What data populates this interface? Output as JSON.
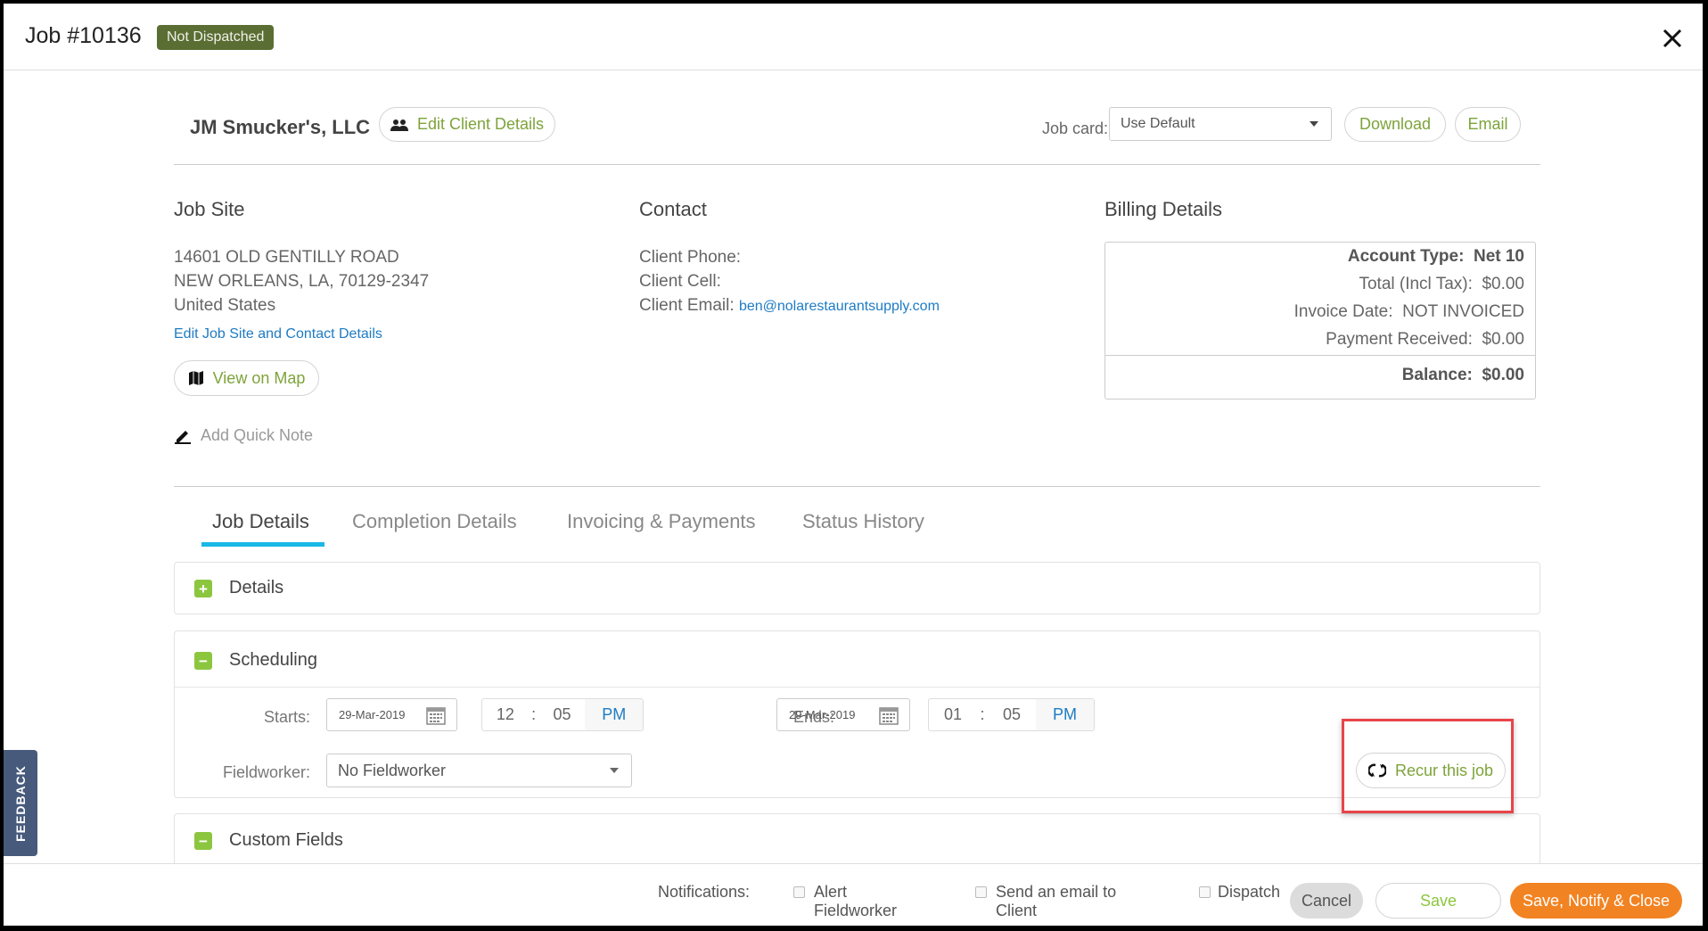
{
  "header": {
    "title": "Job #10136",
    "status_badge": "Not Dispatched",
    "close_icon": "close-icon"
  },
  "client": {
    "name": "JM Smucker's, LLC",
    "edit_button": "Edit Client Details",
    "edit_icon": "people-icon"
  },
  "job_card": {
    "label": "Job card:",
    "selected": "Use Default",
    "download_button": "Download",
    "email_button": "Email"
  },
  "job_site": {
    "heading": "Job Site",
    "address_line1": "14601 OLD GENTILLY ROAD",
    "address_line2": "NEW ORLEANS, LA, 70129-2347",
    "country": "United States",
    "edit_link": "Edit Job Site and Contact Details",
    "map_button": "View on Map",
    "map_icon": "map-icon",
    "quick_note": "Add Quick Note",
    "quick_note_icon": "pencil-icon"
  },
  "contact": {
    "heading": "Contact",
    "phone_label": "Client Phone:",
    "phone_value": "",
    "cell_label": "Client Cell:",
    "cell_value": "",
    "email_label": "Client Email:",
    "email_value": "ben@nolarestaurantsupply.com"
  },
  "billing": {
    "heading": "Billing Details",
    "account_type_label": "Account Type:",
    "account_type_value": "Net 10",
    "total_label": "Total (Incl Tax):",
    "total_value": "$0.00",
    "invoice_date_label": "Invoice Date:",
    "invoice_date_value": "NOT INVOICED",
    "payment_label": "Payment Received:",
    "payment_value": "$0.00",
    "balance_label": "Balance:",
    "balance_value": "$0.00"
  },
  "tabs": [
    {
      "label": "Job Details",
      "active": true
    },
    {
      "label": "Completion Details",
      "active": false
    },
    {
      "label": "Invoicing & Payments",
      "active": false
    },
    {
      "label": "Status History",
      "active": false
    }
  ],
  "panels": {
    "details": {
      "title": "Details",
      "toggle": "+"
    },
    "scheduling": {
      "title": "Scheduling",
      "toggle": "−"
    },
    "custom_fields": {
      "title": "Custom Fields",
      "toggle": "−"
    }
  },
  "scheduling": {
    "starts_label": "Starts:",
    "start_date": "29-Mar-2019",
    "start_hour": "12",
    "start_minute": "05",
    "start_ampm": "PM",
    "ends_label": "Ends:",
    "end_date": "29-Mar-2019",
    "end_hour": "01",
    "end_minute": "05",
    "end_ampm": "PM",
    "time_separator": ":",
    "fieldworker_label": "Fieldworker:",
    "fieldworker_value": "No Fieldworker",
    "recur_button": "Recur this job",
    "recur_icon": "refresh-icon"
  },
  "feedback_tab": "FEEDBACK",
  "footer": {
    "notifications_label": "Notifications:",
    "alert_fieldworker_line1": "Alert",
    "alert_fieldworker_line2": "Fieldworker",
    "alert_fieldworker_checked": false,
    "email_client_line1": "Send an email to",
    "email_client_line2": "Client",
    "email_client_checked": false,
    "dispatch_label": "Dispatch",
    "dispatch_checked": false,
    "cancel_button": "Cancel",
    "save_button": "Save",
    "save_notify_close_button": "Save, Notify & Close"
  },
  "colors": {
    "accent_green": "#7ea33a",
    "status_badge": "#5a6e33",
    "tab_underline": "#1ab8e6",
    "toggle_green": "#8cc63f",
    "primary_orange": "#f28322",
    "link_blue": "#1e7bc4",
    "highlight_red": "#e8454a",
    "feedback_bg": "#475a7c"
  }
}
